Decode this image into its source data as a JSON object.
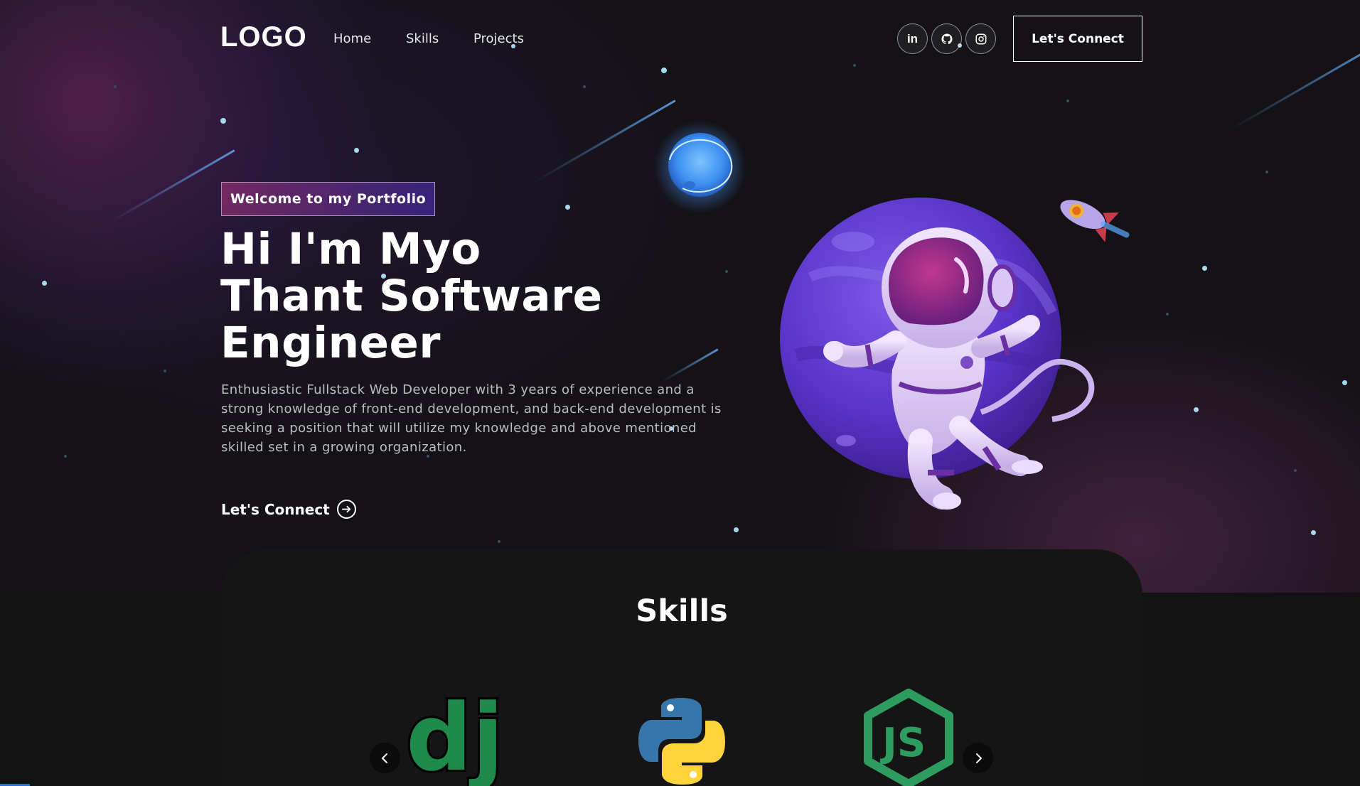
{
  "nav": {
    "logo": "LOGO",
    "links": [
      "Home",
      "Skills",
      "Projects"
    ],
    "social_icons": [
      "linkedin-icon",
      "github-icon",
      "instagram-icon"
    ],
    "connect_label": "Let's Connect"
  },
  "hero": {
    "tagline": "Welcome to my Portfolio",
    "title": "Hi I'm Myo Thant Software Engineer",
    "description": "Enthusiastic Fullstack Web Developer with 3 years of experience and a strong knowledge of front-end development, and back-end development is seeking a position that will utilize my knowledge and above mentioned skilled set in a growing organization.",
    "cta_label": "Let's Connect"
  },
  "skills": {
    "title": "Skills",
    "items": [
      "django-icon",
      "python-icon",
      "nodejs-icon"
    ]
  },
  "colors": {
    "background": "#121212",
    "accent_pink": "#aa367c",
    "accent_purple": "#4a2fbd",
    "django_green": "#1e8b4c",
    "python_blue": "#3776ab",
    "python_yellow": "#ffd43b",
    "node_green": "#2e9c5e"
  }
}
